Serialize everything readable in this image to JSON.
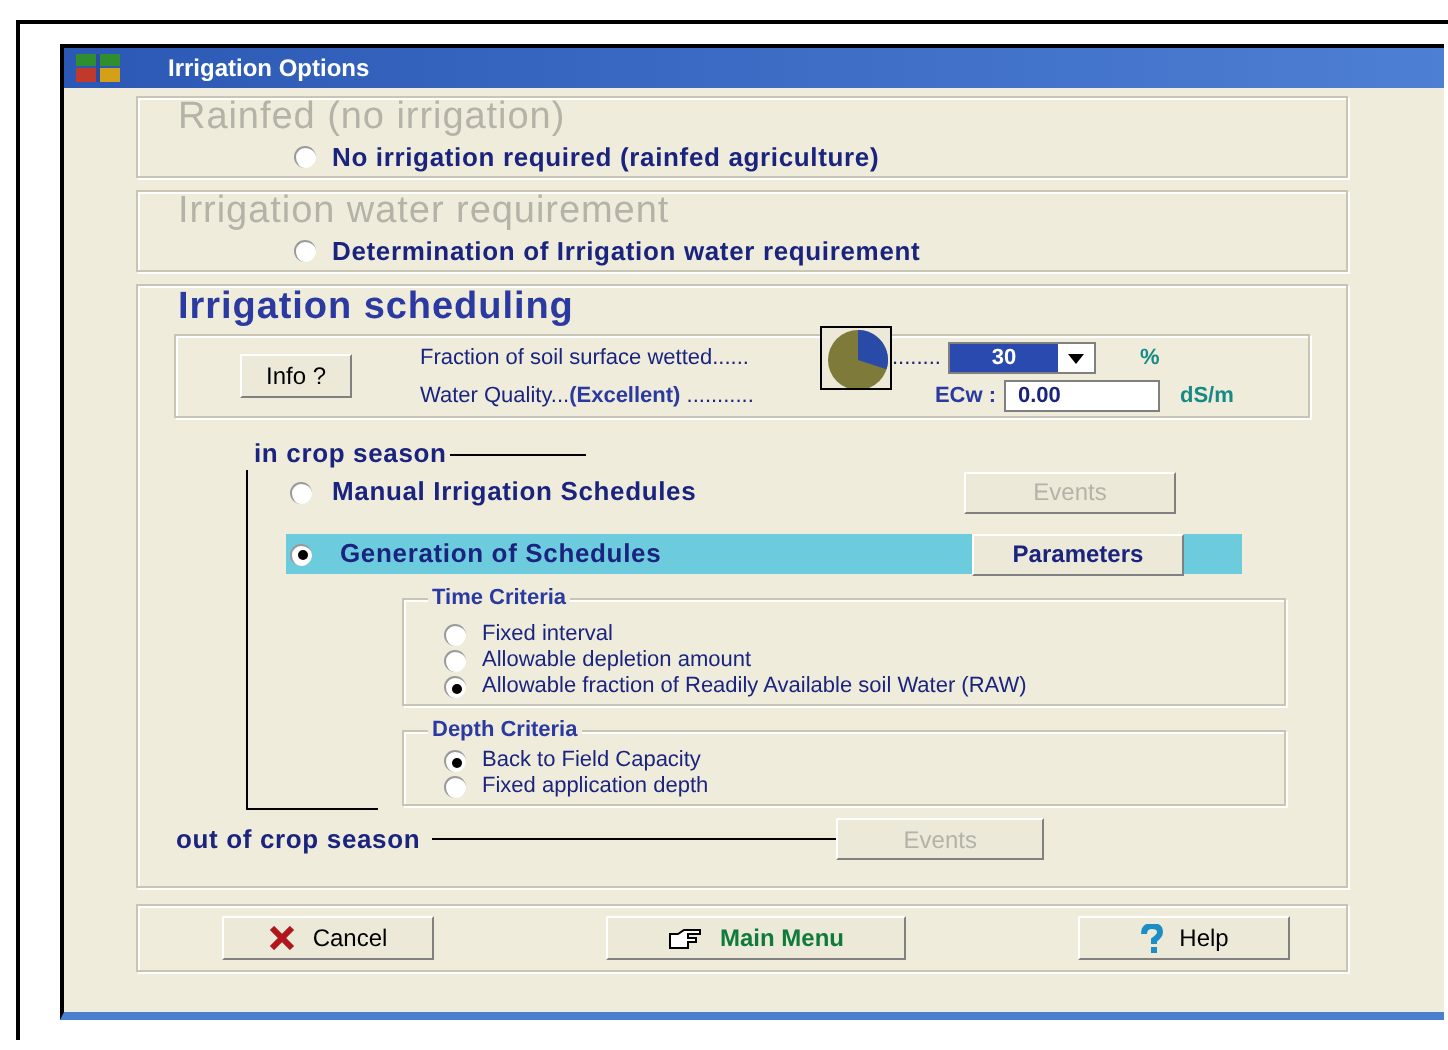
{
  "window": {
    "title": "Irrigation Options"
  },
  "rainfed": {
    "title": "Rainfed (no irrigation)",
    "option": {
      "label": "No irrigation required (rainfed agriculture)",
      "selected": false
    }
  },
  "requirement": {
    "title": "Irrigation water requirement",
    "option": {
      "label": "Determination of Irrigation water requirement",
      "selected": false
    }
  },
  "scheduling": {
    "title": "Irrigation scheduling",
    "info_button": "Info ?",
    "wetted": {
      "label": "Fraction of soil surface wetted......",
      "dots": "........",
      "value": "30",
      "unit": "%"
    },
    "quality": {
      "label": "Water Quality...",
      "rating": "(Excellent)",
      "dots": "...........",
      "ecw_label": "ECw :",
      "value": "0.00",
      "unit": "dS/m"
    },
    "in_season": {
      "title": "in crop season",
      "manual": {
        "label": "Manual Irrigation Schedules",
        "selected": false,
        "button": "Events",
        "disabled": true
      },
      "generation": {
        "label": "Generation of Schedules",
        "selected": true,
        "button": "Parameters",
        "disabled": false
      },
      "time_criteria": {
        "title": "Time Criteria",
        "options": [
          {
            "label": "Fixed interval",
            "selected": false
          },
          {
            "label": "Allowable depletion amount",
            "selected": false
          },
          {
            "label": "Allowable fraction of Readily Available soil Water (RAW)",
            "selected": true
          }
        ]
      },
      "depth_criteria": {
        "title": "Depth Criteria",
        "options": [
          {
            "label": "Back to Field Capacity",
            "selected": true
          },
          {
            "label": "Fixed application depth",
            "selected": false
          }
        ]
      }
    },
    "out_season": {
      "title": "out of crop season",
      "button": "Events",
      "disabled": true
    }
  },
  "buttons": [
    {
      "kind": "cancel",
      "label": "Cancel"
    },
    {
      "kind": "main",
      "label": "Main Menu"
    },
    {
      "kind": "help",
      "label": "Help"
    }
  ]
}
